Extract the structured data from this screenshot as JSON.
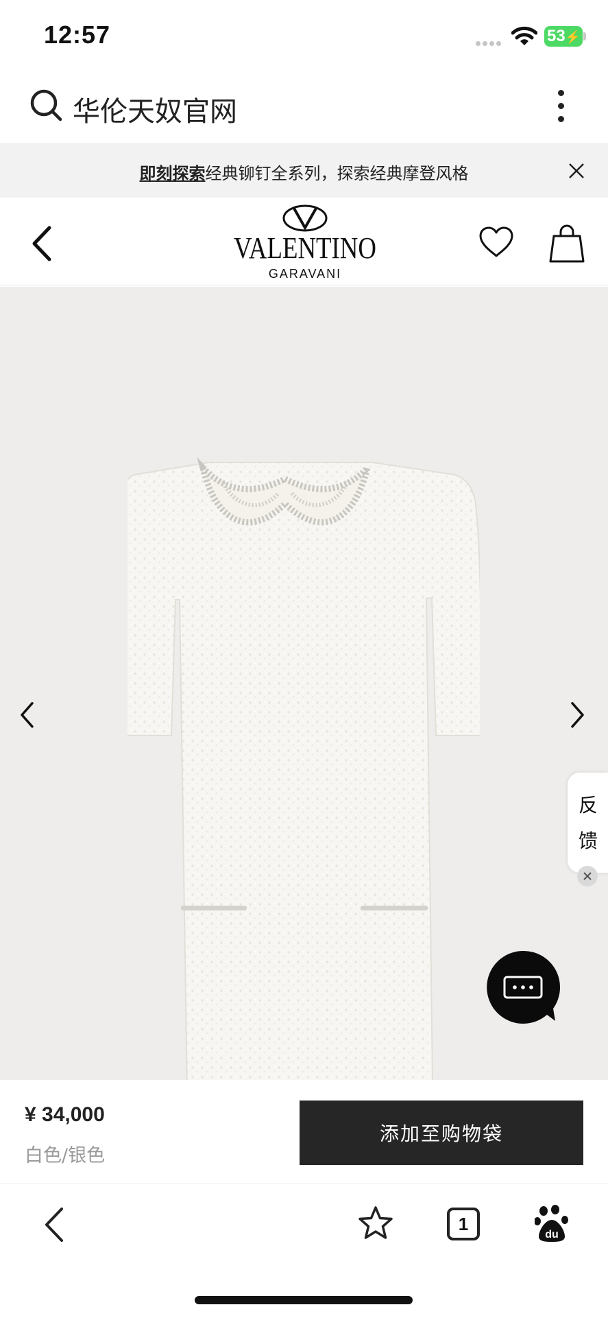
{
  "status_bar": {
    "time": "12:57",
    "battery": "53"
  },
  "search_bar": {
    "query": "华伦天奴官网",
    "icon": "search-icon",
    "menu_icon": "more-vertical-icon"
  },
  "promo_banner": {
    "link_text": "即刻探索",
    "text": "经典铆钉全系列，探索经典摩登风格",
    "close_icon": "close-icon"
  },
  "brand_header": {
    "logo_main": "VALENTINO",
    "logo_sub": "GARAVANI",
    "back_icon": "chevron-left-icon",
    "wishlist_icon": "heart-icon",
    "bag_icon": "shopping-bag-icon"
  },
  "product_gallery": {
    "prev_icon": "chevron-left-icon",
    "next_icon": "chevron-right-icon"
  },
  "feedback": {
    "label": "反馈"
  },
  "chat": {
    "icon": "chat-bubble-icon"
  },
  "product": {
    "price": "¥ 34,000",
    "color": "白色/银色",
    "add_to_bag": "添加至购物袋"
  },
  "bottom_nav": {
    "tab_count": "1",
    "back_icon": "chevron-left-icon",
    "star_icon": "star-icon",
    "tabs_icon": "tabs-icon",
    "baidu_icon": "baidu-paw-icon"
  },
  "colors": {
    "battery": "#4cd964",
    "image_background": "#efedeb",
    "banner_background": "#f2f2f2",
    "button_background": "#262626"
  }
}
